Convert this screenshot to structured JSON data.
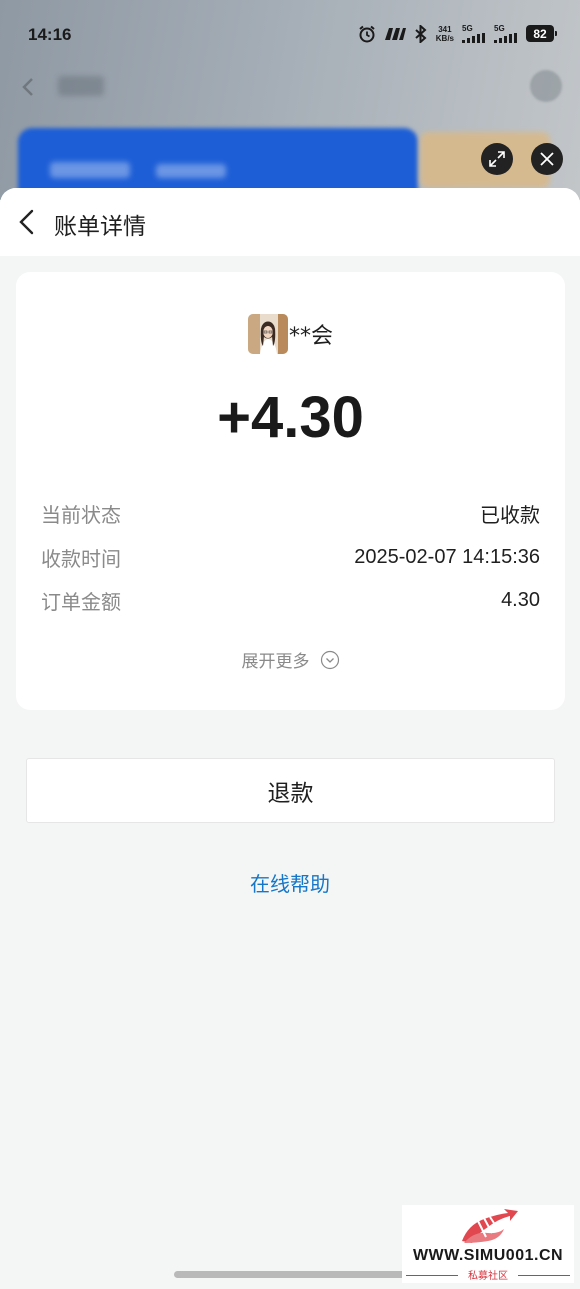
{
  "status_bar": {
    "time": "14:16",
    "net_speed_value": "341",
    "net_speed_unit": "KB/s",
    "signal1_label": "5G",
    "signal2_label": "5G",
    "battery": "82"
  },
  "sheet": {
    "title": "账单详情"
  },
  "bill": {
    "payer_name": "**会",
    "amount": "+4.30",
    "rows": [
      {
        "label": "当前状态",
        "value": "已收款"
      },
      {
        "label": "收款时间",
        "value": "2025-02-07 14:15:36"
      },
      {
        "label": "订单金额",
        "value": "4.30"
      }
    ],
    "expand_label": "展开更多"
  },
  "actions": {
    "refund_label": "退款",
    "help_label": "在线帮助"
  },
  "watermark": {
    "site": "WWW.SIMU001.CN",
    "subtitle": "私募社区"
  },
  "colors": {
    "link": "#1677c8",
    "background": "#f4f5f5",
    "watermark_red": "#d6343f"
  }
}
